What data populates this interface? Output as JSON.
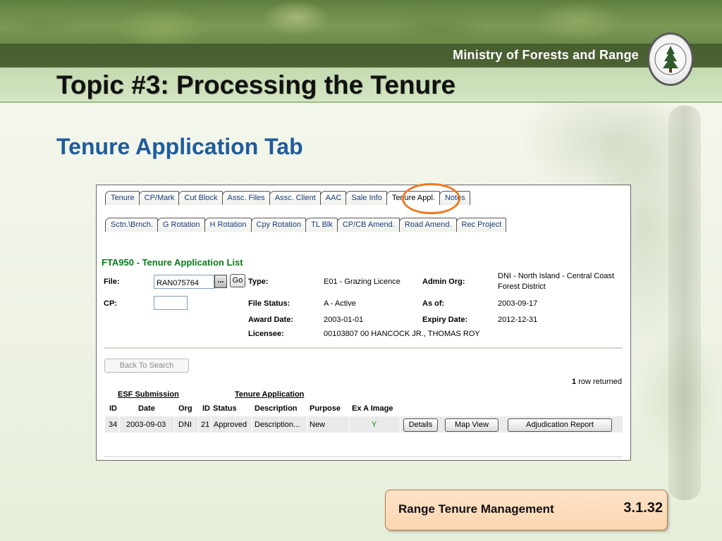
{
  "header": {
    "ministry": "Ministry of Forests and Range",
    "seal_label": "FOREST SERVICE BRITISH COLUMBIA"
  },
  "slide": {
    "title": "Topic #3: Processing the Tenure",
    "subtitle": "Tenure Application Tab"
  },
  "tabs_row1": [
    "Tenure",
    "CP/Mark",
    "Cut Block",
    "Assc. Files",
    "Assc. Client",
    "AAC",
    "Sale Info",
    "Tenure Appl.",
    "Notes"
  ],
  "tabs_row2": [
    "Sctn.\\Brnch.",
    "G Rotation",
    "H Rotation",
    "Cpy Rotation",
    "TL Blk",
    "CP/CB Amend.",
    "Road Amend.",
    "Rec Project"
  ],
  "active_tab": "Tenure Appl.",
  "screen": {
    "title": "FTA950 - Tenure Application List",
    "file_label": "File:",
    "file_value": "RAN075764",
    "browse_label": "...",
    "go_label": "Go",
    "cp_label": "CP:",
    "cp_value": "",
    "type_label": "Type:",
    "type_value": "E01 - Grazing Licence",
    "admin_org_label": "Admin Org:",
    "admin_org_value_line1": "DNI - North Island - Central Coast",
    "admin_org_value_line2": "Forest District",
    "file_status_label": "File Status:",
    "file_status_value": "A - Active",
    "as_of_label": "As of:",
    "as_of_value": "2003-09-17",
    "award_date_label": "Award Date:",
    "award_date_value": "2003-01-01",
    "expiry_date_label": "Expiry Date:",
    "expiry_date_value": "2012-12-31",
    "licensee_label": "Licensee:",
    "licensee_value": "00103807 00 HANCOCK JR., THOMAS ROY",
    "back_button": "Back To Search",
    "rows_count": "1",
    "rows_text": "row returned"
  },
  "table": {
    "group_esf": "ESF Submission",
    "group_tenure": "Tenure Application",
    "columns": [
      "ID",
      "Date",
      "Org",
      "ID",
      "Status",
      "Description",
      "Purpose",
      "Ex A Image"
    ],
    "row": {
      "esf_id": "34",
      "date": "2003-09-03",
      "org": "DNI",
      "app_id": "21",
      "status": "Approved",
      "description": "Description...",
      "purpose": "New",
      "ex_a_image": "Y",
      "details_btn": "Details",
      "map_btn": "Map View",
      "adjudication_btn": "Adjudication Report"
    }
  },
  "footer": {
    "course": "Range Tenure Management",
    "slide_number": "3.1.32"
  },
  "colors": {
    "title_blue": "#1f5b9c",
    "screen_title_green": "#0a7a1a",
    "highlight_orange": "#ee7a22",
    "footer_peach": "#fbd6b1"
  }
}
